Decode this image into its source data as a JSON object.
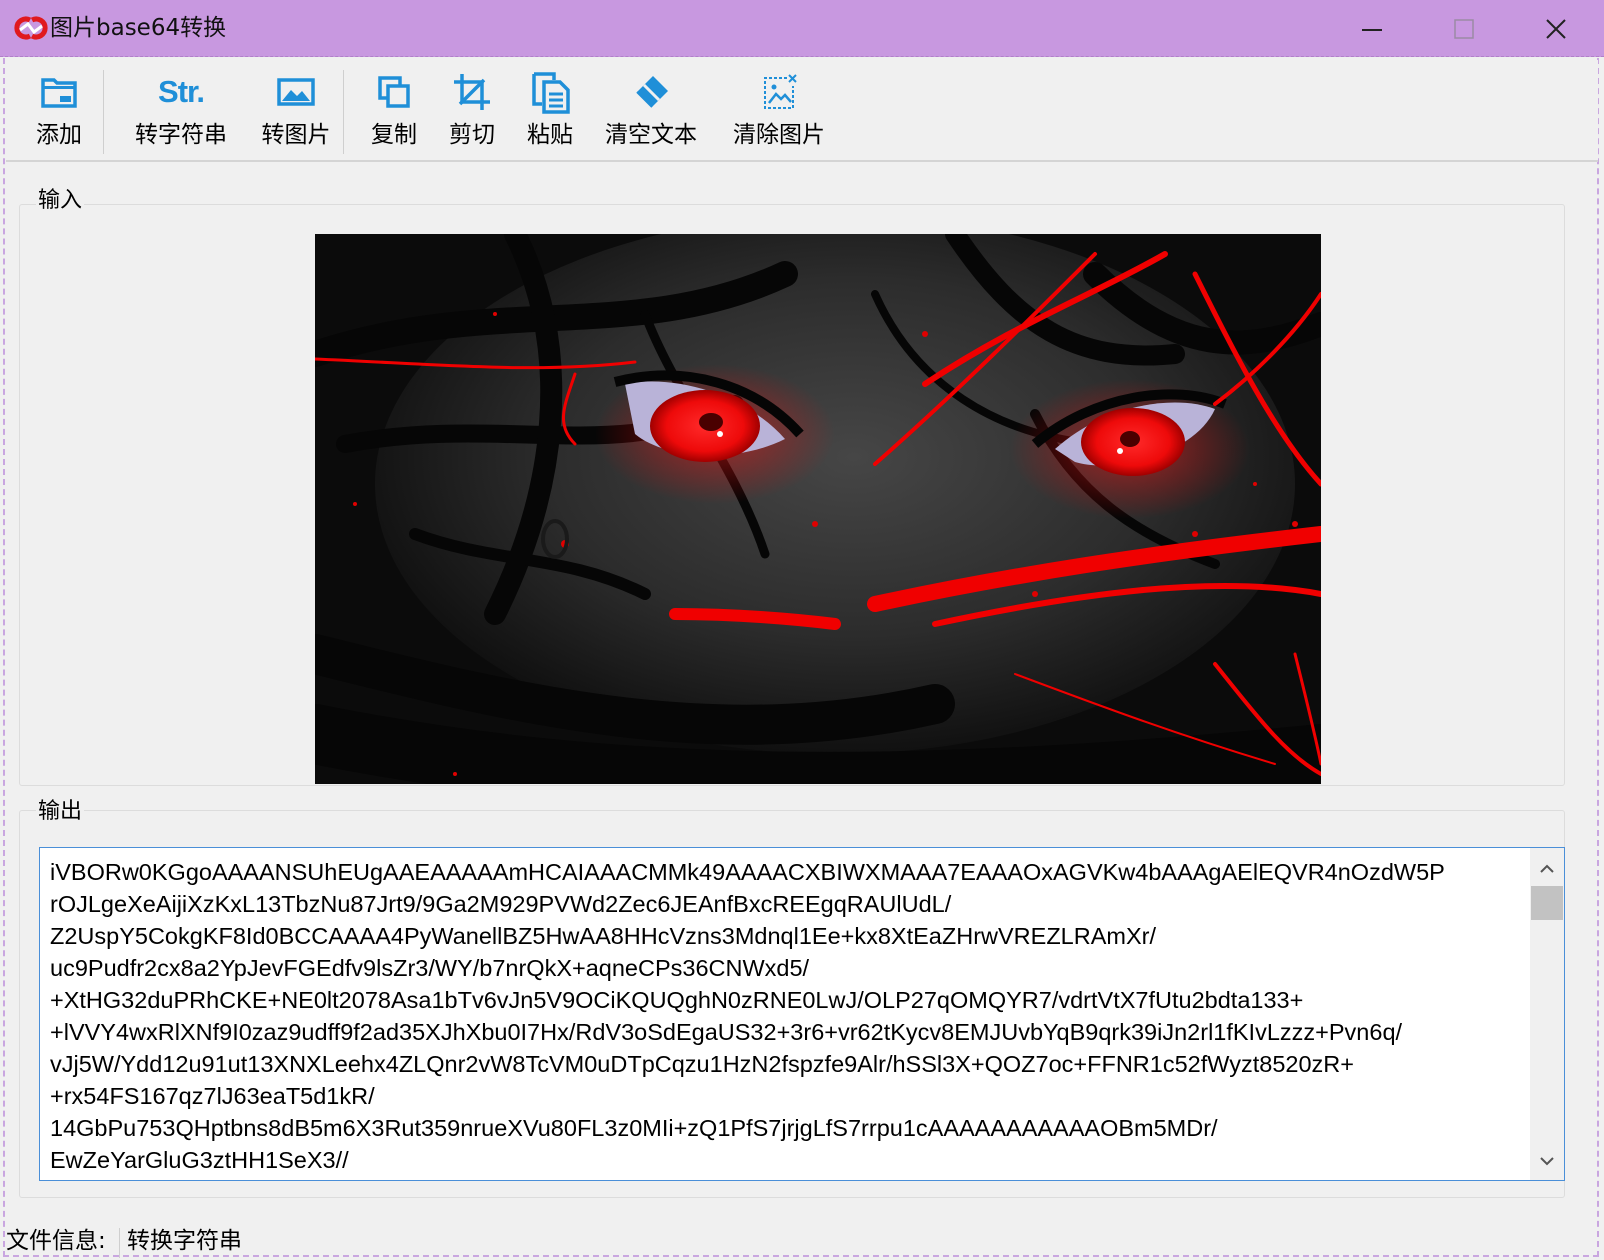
{
  "window": {
    "title": "图片base64转换"
  },
  "toolbar": {
    "add_label": "添加",
    "to_string_label": "转字符串",
    "to_image_label": "转图片",
    "copy_label": "复制",
    "cut_label": "剪切",
    "paste_label": "粘贴",
    "clear_text_label": "清空文本",
    "clear_image_label": "清除图片",
    "to_string_icon_text": "Str."
  },
  "input_group": {
    "title": "输入"
  },
  "output_group": {
    "title": "输出",
    "lines": [
      "iVBORw0KGgoAAAANSUhEUgAAEAAAAAmHCAIAAACMMk49AAAACXBIWXMAAA7EAAAOxAGVKw4bAAAgAElEQVR4nOzdW5P",
      "rOJLgeXeAijiXzKxL13TbzNu87Jrt9/9Ga2M929PVWd2Zec6JEAnfBxcREEgqRAUlUdL/",
      "Z2UspY5CokgKF8Id0BCCAAAA4PyWanellBZ5HwAA8HHcVzns3Mdnql1Ee+kx8XtEaZHrwVREZLRAmXr/",
      "uc9Pudfr2cx8a2YpJevFGEdfv9lsZr3/WY/b7nrQkX+aqneCPs36CNWxd5/",
      "+XtHG32duPRhCKE+NE0lt2078Asa1bTv6vJn5V9OCiKQUQghN0zRNE0LwJ/OLP27qOMQYR7/vdrtVtX7fUtu2bdta133+",
      "+lVVY4wxRlXNf9I0zaz9udff9f2ad35XJhXbu0I7Hx/RdV3oSdEgaUS32+3r6+vr62tKycv8EMJUvbYqB9qrk39iJn2rl1fKIvLzzz+Pvn6q/",
      "vJj5W/Ydd12u91ut13XNXLeehx4ZLQnr2vW8TcVM0uDTpCqzu1HzN2fspzfe9Alr/hSSl3X+QOZ7oc+FFNR1c52fWyzt8520zR+",
      "+rx54FS167qz7lJ63eaT5d1kR/",
      "14GbPu753QHptbns8dB5m6X3Rut359nrueXVu80FL3z0MIi+zQ1PfS7jrjgLfS7rrpu1cAAAAAAAAAAAOBm5MDr/",
      "EwZeYarGluG3ztHH1SeX3//"
    ]
  },
  "statusbar": {
    "label": "文件信息:",
    "value": "转换字符串"
  },
  "colors": {
    "titlebar_bg": "#c898e0",
    "icon_blue": "#1f8fd8",
    "logo_red": "#e0191e",
    "focus_border": "#4a8fd8"
  },
  "icons": {
    "add": "folder-icon",
    "to_string": "string-icon",
    "to_image": "image-icon",
    "copy": "copy-icon",
    "cut": "crop-icon",
    "paste": "paste-icon",
    "clear_text": "eraser-icon",
    "clear_image": "clear-image-icon",
    "minimize": "minimize-icon",
    "maximize": "maximize-icon",
    "close": "close-icon"
  }
}
